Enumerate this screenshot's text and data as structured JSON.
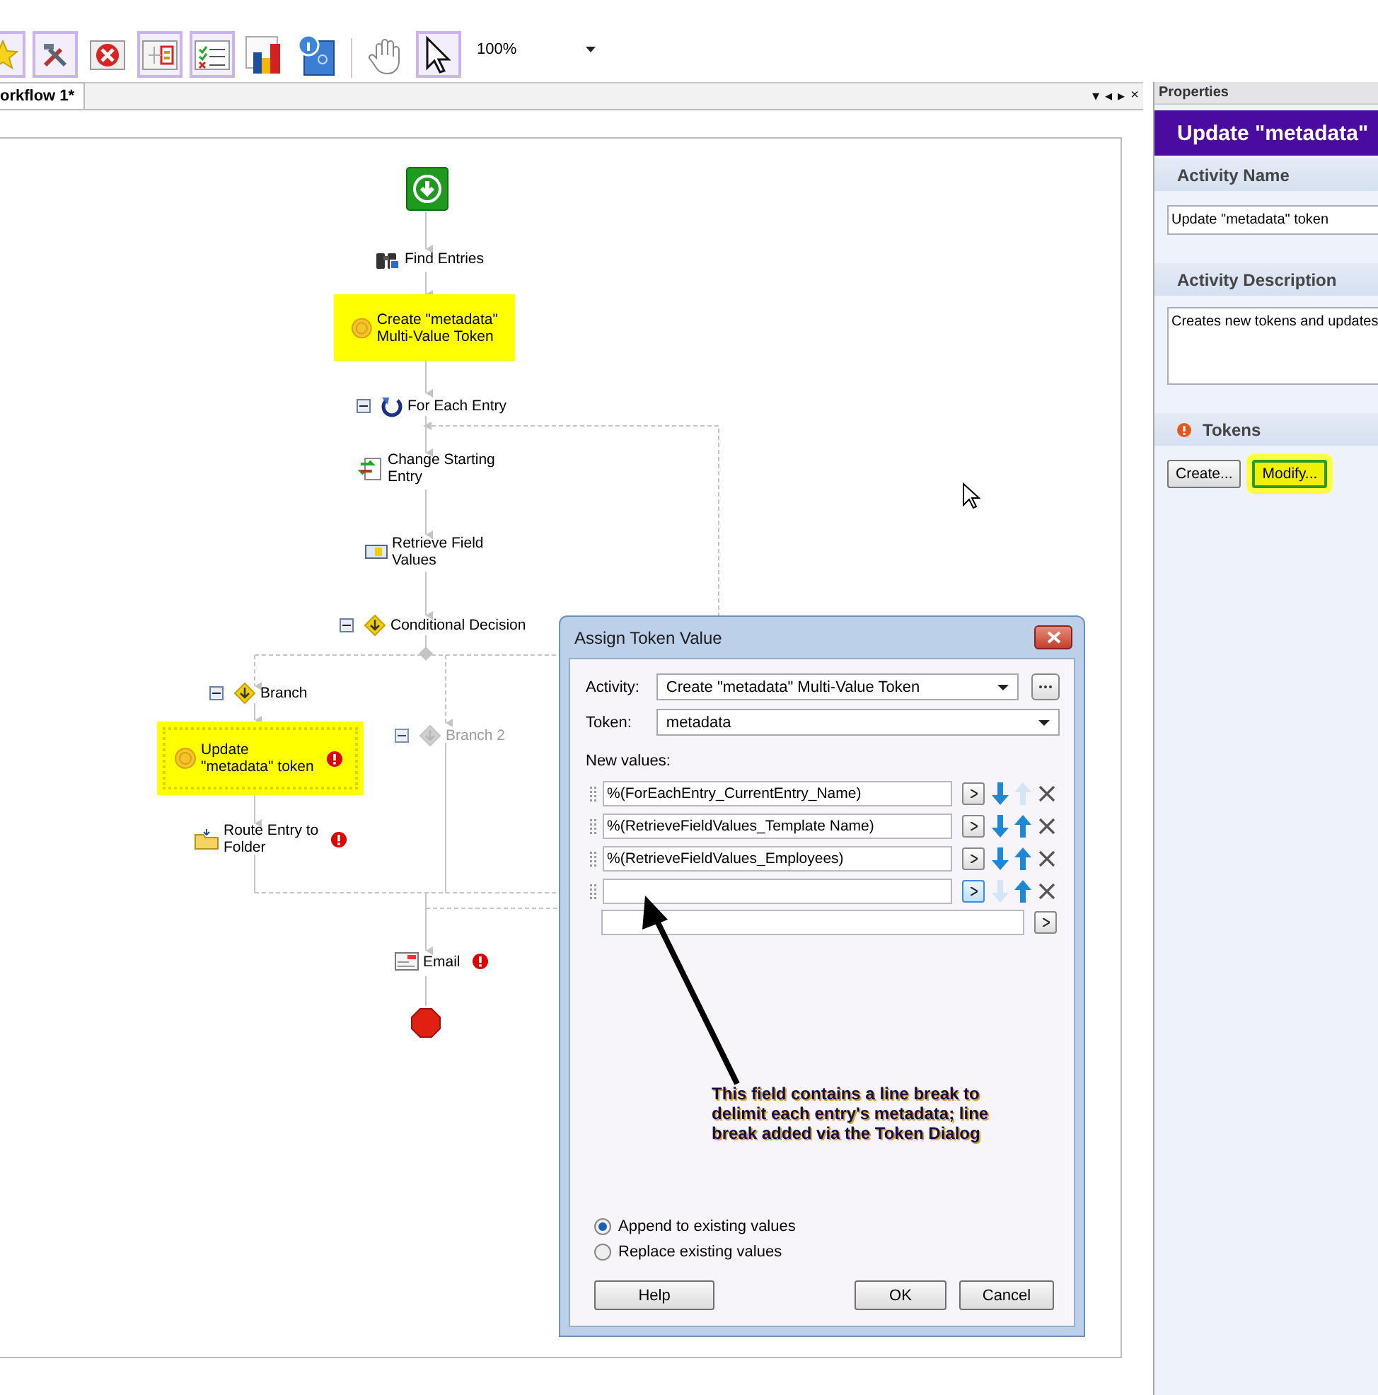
{
  "toolbar": {
    "buttons": [
      {
        "kind": "favorite",
        "selected": true
      },
      {
        "kind": "tools",
        "selected": true
      },
      {
        "kind": "delete",
        "selected": false
      },
      {
        "kind": "flow",
        "selected": true
      },
      {
        "kind": "checklist",
        "selected": true
      },
      {
        "kind": "chart",
        "selected": false
      },
      {
        "kind": "info_doc",
        "selected": false
      },
      {
        "kind": "hand",
        "selected": false
      },
      {
        "kind": "pointer",
        "selected": true
      }
    ],
    "zoom": "100%"
  },
  "document_tab": {
    "label": "orkflow 1*",
    "selected": true
  },
  "tab_controls": [
    "▾",
    "◂",
    "▸",
    "×"
  ],
  "workflow": {
    "nodes": [
      {
        "kind": "start",
        "highlighted": false,
        "selected": false,
        "error": false,
        "disabled": false
      },
      {
        "kind": "search",
        "label": "Find Entries",
        "highlighted": false,
        "selected": false,
        "error": false,
        "disabled": false
      },
      {
        "kind": "token",
        "label": "Create \"metadata\"\nMulti-Value Token",
        "highlighted": true,
        "selected": false,
        "error": false,
        "disabled": false
      },
      {
        "kind": "loop",
        "label": "For Each Entry",
        "highlighted": false,
        "selected": false,
        "error": false,
        "disabled": false,
        "expanded": true
      },
      {
        "kind": "change_entry",
        "label": "Change Starting\nEntry",
        "highlighted": false,
        "selected": false,
        "error": false,
        "disabled": false
      },
      {
        "kind": "retrieve",
        "label": "Retrieve Field\nValues",
        "highlighted": false,
        "selected": false,
        "error": false,
        "disabled": false
      },
      {
        "kind": "decision",
        "label": "Conditional Decision",
        "highlighted": false,
        "selected": false,
        "error": false,
        "disabled": false,
        "expanded": true
      },
      {
        "kind": "branch",
        "label": "Branch",
        "highlighted": false,
        "selected": false,
        "error": false,
        "disabled": false,
        "expanded": true
      },
      {
        "kind": "branch",
        "label": "Branch 2",
        "highlighted": false,
        "selected": false,
        "error": false,
        "disabled": true,
        "expanded": true
      },
      {
        "kind": "token",
        "label": "Update\n\"metadata\" token",
        "highlighted": true,
        "selected": true,
        "error": true,
        "disabled": false
      },
      {
        "kind": "route",
        "label": "Route Entry to\nFolder",
        "highlighted": false,
        "selected": false,
        "error": true,
        "disabled": false
      },
      {
        "kind": "email",
        "label": "Email",
        "highlighted": false,
        "selected": false,
        "error": true,
        "disabled": false
      },
      {
        "kind": "end",
        "highlighted": false,
        "selected": false,
        "error": false,
        "disabled": false
      }
    ]
  },
  "dialog": {
    "title": "Assign Token Value",
    "activity": {
      "label": "Activity:",
      "value": "Create \"metadata\" Multi-Value Token"
    },
    "token": {
      "label": "Token:",
      "value": "metadata"
    },
    "new_values_label": "New values:",
    "values": [
      {
        "value": "%(ForEachEntry_CurrentEntry_Name)",
        "move_down_enabled": true,
        "move_up_enabled": false,
        "insert_focused": false
      },
      {
        "value": "%(RetrieveFieldValues_Template Name)",
        "move_down_enabled": true,
        "move_up_enabled": true,
        "insert_focused": false
      },
      {
        "value": "%(RetrieveFieldValues_Employees)",
        "move_down_enabled": true,
        "move_up_enabled": true,
        "insert_focused": false
      },
      {
        "move_down_enabled": false,
        "move_up_enabled": true,
        "insert_focused": true
      }
    ],
    "annotation": "This field contains a line break to delimit each entry's metadata; line break added via the Token Dialog",
    "options": [
      {
        "label": "Append to existing values",
        "selected": true
      },
      {
        "label": "Replace existing values",
        "selected": false
      }
    ],
    "buttons": [
      "Help",
      "OK",
      "Cancel"
    ]
  },
  "properties": {
    "header": "Properties",
    "title": "Update \"metadata\"",
    "sections": [
      {
        "kind": "field",
        "heading": "Activity Name",
        "value": "Update \"metadata\" token"
      },
      {
        "kind": "textarea",
        "heading": "Activity Description",
        "value": "Creates new tokens and updates"
      },
      {
        "kind": "buttons",
        "heading": "Tokens",
        "warning": true,
        "buttons": [
          {
            "label": "Create...",
            "highlighted": false
          },
          {
            "label": "Modify...",
            "highlighted": true
          }
        ]
      }
    ]
  }
}
